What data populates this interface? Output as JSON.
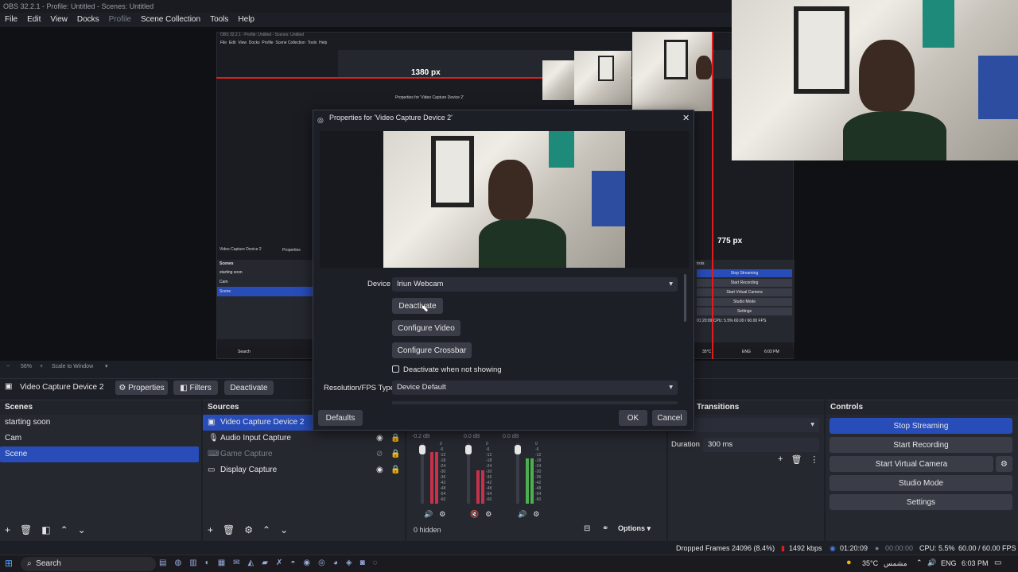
{
  "window": {
    "title": "OBS 32.2.1 - Profile: Untitled - Scenes: Untitled"
  },
  "menu": [
    {
      "label": "File",
      "dim": false
    },
    {
      "label": "Edit",
      "dim": false
    },
    {
      "label": "View",
      "dim": false
    },
    {
      "label": "Docks",
      "dim": false
    },
    {
      "label": "Profile",
      "dim": true
    },
    {
      "label": "Scene Collection",
      "dim": false
    },
    {
      "label": "Tools",
      "dim": false
    },
    {
      "label": "Help",
      "dim": false
    }
  ],
  "preview": {
    "measure_horizontal": "1380 px",
    "measure_vertical": "775 px",
    "zoom": "56%",
    "scale_mode": "Scale to Window"
  },
  "nested": {
    "title": "OBS 32.2.1 - Profile: Untitled - Scenes: Untitled",
    "menu": "File  Edit  View  Docks  Profile  Scene Collection  Tools  Help",
    "source_label": "Video Capture Device 2",
    "properties": "Properties",
    "scenes_header": "Scenes",
    "scenes": [
      "starting soon",
      "Cam",
      "Scene"
    ],
    "controls": [
      "Stop Streaming",
      "Start Recording",
      "Start Virtual Camera",
      "Studio Mode",
      "Settings"
    ],
    "controls_header": "trols",
    "status": "01:20:09   CPU: 5.5%   60.00 / 60.00 FPS",
    "search": "Search",
    "weather": "35°C",
    "time": "6:03 PM",
    "lang": "ENG",
    "props_title": "Properties for 'Video Capture Device 2'"
  },
  "dialog": {
    "title": "Properties for 'Video Capture Device 2'",
    "device_label": "Device",
    "device_value": "Iriun Webcam",
    "deactivate": "Deactivate",
    "configure_video": "Configure Video",
    "configure_crossbar": "Configure Crossbar",
    "deactivate_when_hidden": "Deactivate when not showing",
    "resolution_label": "Resolution/FPS Type",
    "resolution_value": "Device Default",
    "defaults": "Defaults",
    "ok": "OK",
    "cancel": "Cancel"
  },
  "source_bar": {
    "source_name": "Video Capture Device 2",
    "properties": "Properties",
    "filters": "Filters",
    "deactivate": "Deactivate"
  },
  "scenes": {
    "header": "Scenes",
    "items": [
      {
        "label": "starting soon",
        "selected": false
      },
      {
        "label": "Cam",
        "selected": false
      },
      {
        "label": "Scene",
        "selected": true
      }
    ]
  },
  "sources": {
    "header": "Sources",
    "items": [
      {
        "label": "Video Capture Device 2",
        "icon": "camera-icon",
        "selected": true,
        "dim": false
      },
      {
        "label": "Audio Input Capture",
        "icon": "microphone-icon",
        "selected": false,
        "dim": false
      },
      {
        "label": "Game Capture",
        "icon": "gamepad-icon",
        "selected": false,
        "dim": true
      },
      {
        "label": "Display Capture",
        "icon": "monitor-icon",
        "selected": false,
        "dim": false
      }
    ]
  },
  "mixer": {
    "channels": [
      {
        "db": "-0.2 dB",
        "level": 0.85,
        "color": "#c8314a",
        "muted": false
      },
      {
        "db": "0.0 dB",
        "level": 0.55,
        "color": "#c8314a",
        "muted": true
      },
      {
        "db": "0.0 dB",
        "level": 0.75,
        "color": "#4caf50",
        "muted": false
      }
    ],
    "scale": [
      "0",
      "-6",
      "-12",
      "-18",
      "-24",
      "-30",
      "-36",
      "-42",
      "-48",
      "-54",
      "-60"
    ],
    "hidden": "0 hidden",
    "options": "Options"
  },
  "transitions": {
    "header": "Transitions",
    "duration_label": "Duration",
    "duration_value": "300 ms"
  },
  "controls": {
    "header": "Controls",
    "stop_streaming": "Stop Streaming",
    "start_recording": "Start Recording",
    "start_virtual_camera": "Start Virtual Camera",
    "studio_mode": "Studio Mode",
    "settings": "Settings"
  },
  "status_bar": {
    "dropped": "Dropped Frames 24096 (8.4%)",
    "bitrate": "1492 kbps",
    "stream_time": "01:20:09",
    "record_time": "00:00:00",
    "cpu": "CPU: 5.5%",
    "fps": "60.00 / 60.00 FPS"
  },
  "taskbar": {
    "search": "Search",
    "weather": "35°C",
    "weather_text": "مشمس",
    "lang": "ENG",
    "time": "6:03 PM"
  },
  "colors": {
    "accent": "#284cb8",
    "red_guide": "#e21d1d"
  }
}
